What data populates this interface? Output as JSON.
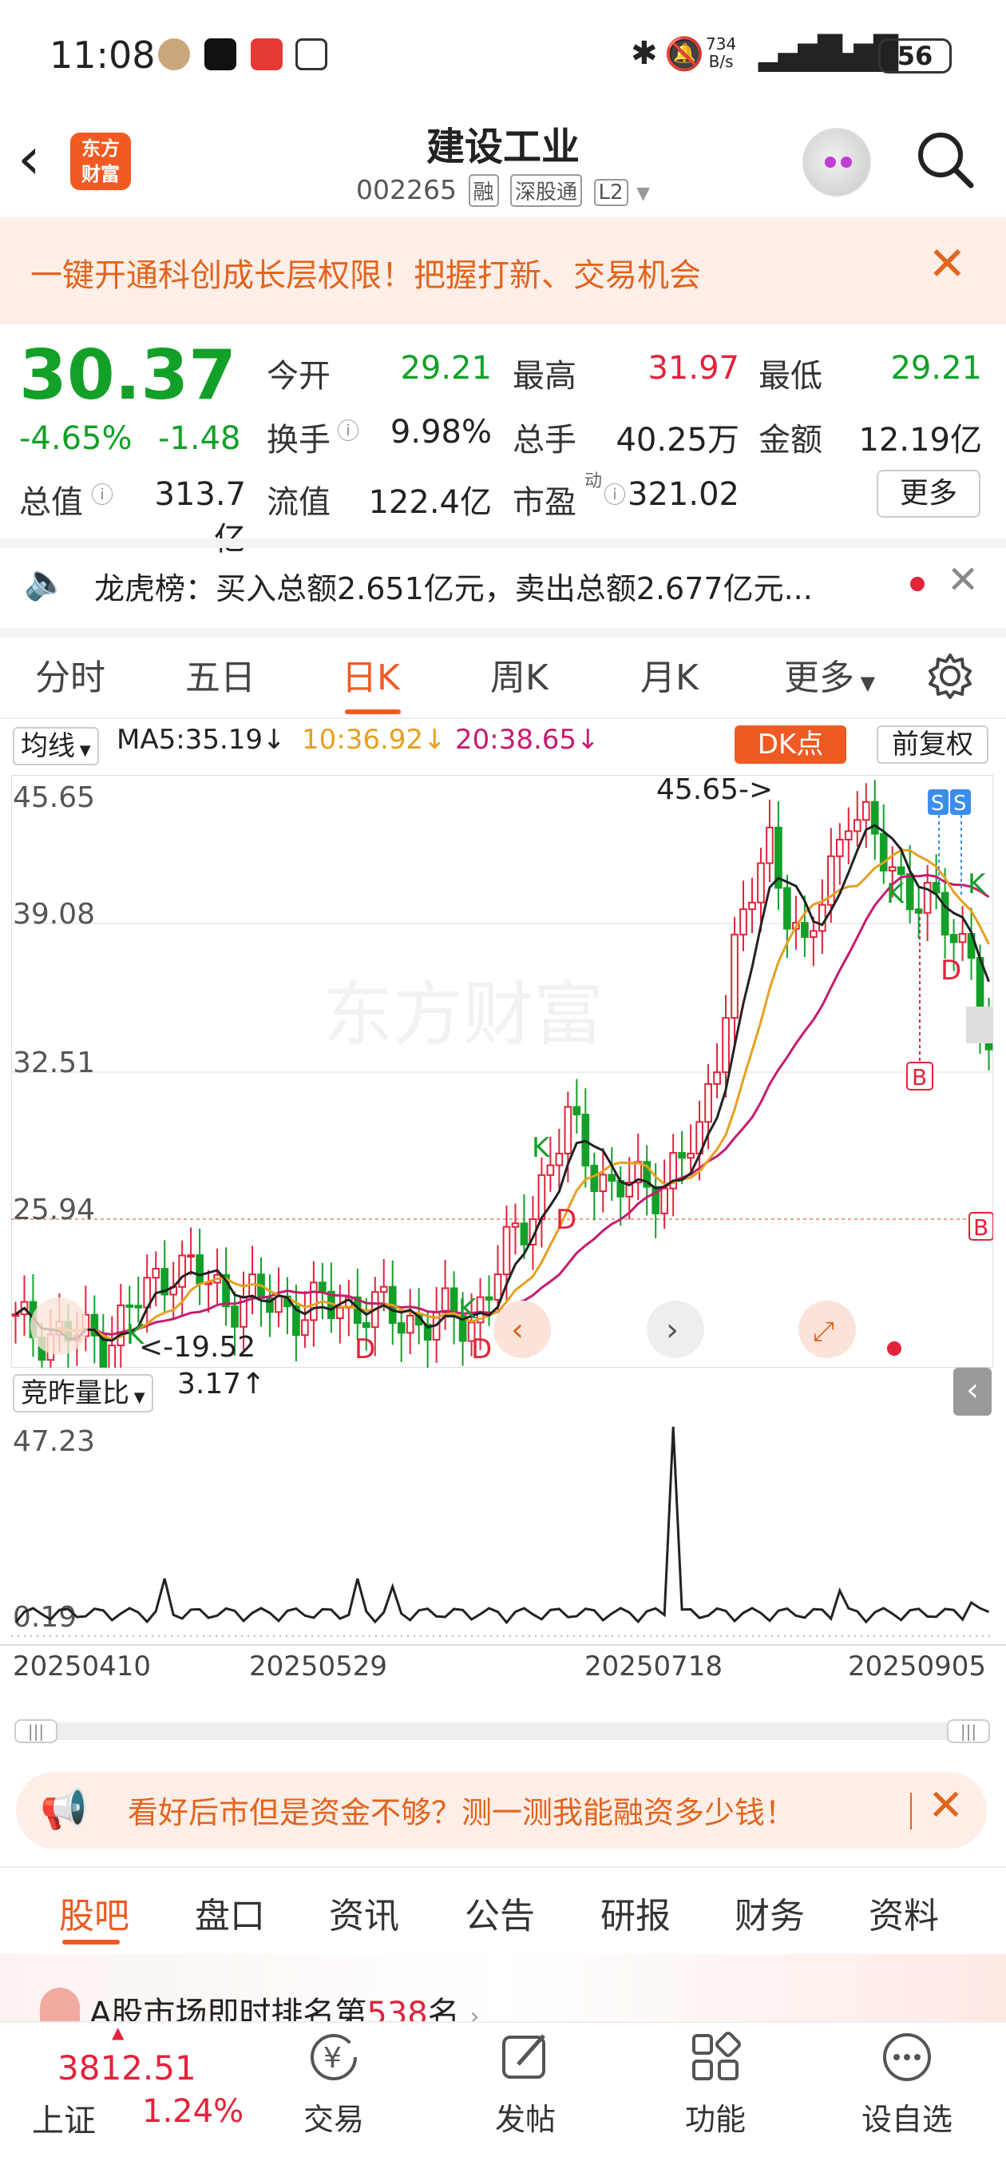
{
  "status": {
    "time": "11:08",
    "net_speed": "734\nB/s",
    "battery": "56"
  },
  "header": {
    "logo_text": "东方\n财富",
    "title": "建设工业",
    "code": "002265",
    "tags": [
      "融",
      "深股通",
      "L2"
    ]
  },
  "banner": {
    "text": "一键开通科创成长层权限！把握打新、交易机会"
  },
  "quote": {
    "price": "30.37",
    "change_pct": "-4.65%",
    "change": "-1.48",
    "open_label": "今开",
    "open": "29.21",
    "high_label": "最高",
    "high": "31.97",
    "low_label": "最低",
    "low": "29.21",
    "turnover_label": "换手",
    "turnover": "9.98%",
    "volume_label": "总手",
    "volume": "40.25万",
    "amount_label": "金额",
    "amount": "12.19亿",
    "mktcap_label": "总值",
    "mktcap": "313.7亿",
    "float_label": "流值",
    "float": "122.4亿",
    "pe_label": "市盈",
    "pe_sup": "动",
    "pe": "321.02",
    "more": "更多"
  },
  "dragon": {
    "text": "龙虎榜：买入总额2.651亿元，卖出总额2.677亿元..."
  },
  "ktabs": [
    "分时",
    "五日",
    "日K",
    "周K",
    "月K",
    "更多"
  ],
  "ma": {
    "selector": "均线",
    "ma5": "MA5:35.19",
    "ma10": "10:36.92",
    "ma20": "20:38.65",
    "dk": "DK点",
    "adjust": "前复权"
  },
  "chart_labels": {
    "y1": "45.65",
    "y2": "39.08",
    "y3": "32.51",
    "y4": "25.94",
    "high_note": "45.65->",
    "low_note": "<-19.52",
    "watermark": "东方财富",
    "markers": [
      "K",
      "D",
      "K",
      "D",
      "K",
      "D",
      "K",
      "D",
      "B",
      "K",
      "D",
      "S",
      "S",
      "B"
    ]
  },
  "volume": {
    "selector": "竞昨量比",
    "value": "3.17",
    "y_top": "47.23",
    "y_bottom": "0.19"
  },
  "dates": [
    "20250410",
    "20250529",
    "20250718",
    "20250905"
  ],
  "promo": {
    "text": "看好后市但是资金不够？测一测我能融资多少钱！"
  },
  "btabs": [
    "股吧",
    "盘口",
    "资讯",
    "公告",
    "研报",
    "财务",
    "资料"
  ],
  "rank": {
    "prefix": "A股市场即时排名第",
    "num": "538",
    "suffix": "名"
  },
  "index": {
    "value": "3812.51",
    "name": "上证",
    "pct": "1.24%"
  },
  "nav": [
    "交易",
    "发帖",
    "功能",
    "设自选"
  ],
  "colors": {
    "accent": "#f05a22",
    "up": "#e2233a",
    "down": "#13a028",
    "ma5": "#222222",
    "ma10": "#e6a020",
    "ma20": "#c81b6f"
  }
}
